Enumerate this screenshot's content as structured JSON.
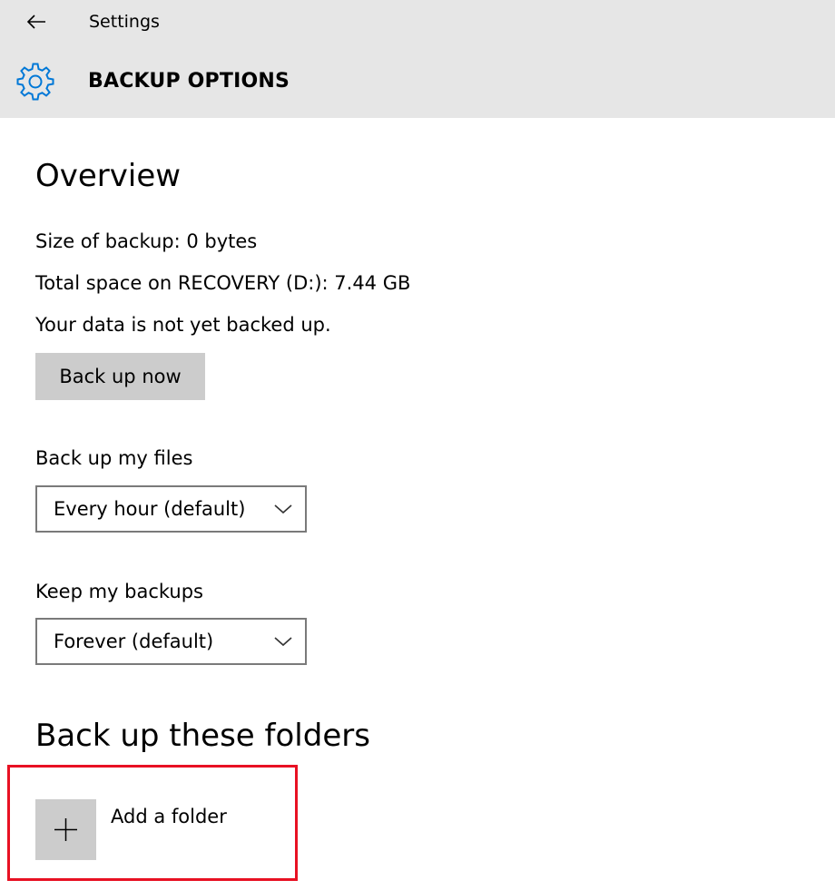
{
  "header": {
    "app_title": "Settings",
    "page_title": "BACKUP OPTIONS",
    "back_icon": "back-arrow-icon",
    "page_icon": "gear-icon"
  },
  "overview": {
    "title": "Overview",
    "size_of_backup": "Size of backup: 0 bytes",
    "total_space": "Total space on RECOVERY (D:): 7.44 GB",
    "status": "Your data is not yet backed up.",
    "back_up_now_label": "Back up now"
  },
  "frequency": {
    "label": "Back up my files",
    "selected": "Every hour (default)"
  },
  "retention": {
    "label": "Keep my backups",
    "selected": "Forever (default)"
  },
  "folders": {
    "title": "Back up these folders",
    "add_folder_label": "Add a folder",
    "add_icon": "plus-icon"
  },
  "colors": {
    "header_bg": "#e6e6e6",
    "accent": "#0078d7",
    "button_bg": "#cccccc",
    "highlight": "#e81123"
  }
}
